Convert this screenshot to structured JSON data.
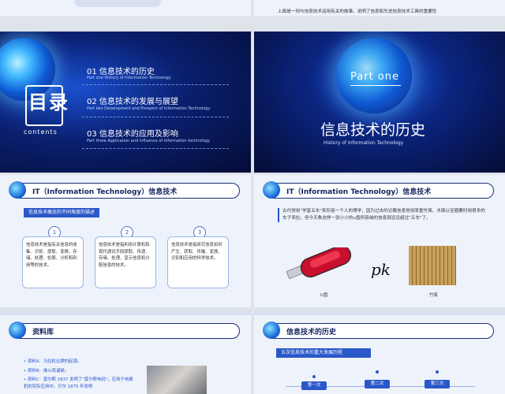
{
  "top_strip": {
    "caption": "上面是一则与信息技术运用有关的故事。说明了信息和先进信息技术工具的重要性"
  },
  "toc_slide": {
    "title": "目录",
    "subtitle": "contents",
    "items": [
      {
        "main": "01 信息技术的历史",
        "sub": "Part one History of Information Technology"
      },
      {
        "main": "02 信息技术的发展与展望",
        "sub": "Part two Development and Prospect of Information Technology"
      },
      {
        "main": "03 信息技术的应用及影响",
        "sub": "Part three Application and influence of information technology"
      }
    ]
  },
  "part_slide": {
    "badge": "Part one",
    "title": "信息技术的历史",
    "subtitle": "History of Information Technology"
  },
  "it_slide_left": {
    "header": "IT（Information Technology）信息技术",
    "tag": "信息技术概念的不同角度的描述",
    "cards": [
      {
        "num": "1",
        "text": "信息技术是指有关信息的收集、识别、提取、变换、存储、处理、检索、分析和利用等的技术。"
      },
      {
        "num": "2",
        "text": "信息技术是指利用计算机和现代通讯手段获取、传递、存储、处理、显示信息和分配信息的技术。"
      },
      {
        "num": "3",
        "text": "信息技术是指研究信息如何产生、获取、传输、变换、识别和应用的科学技术。"
      }
    ]
  },
  "it_slide_right": {
    "header": "IT（Information Technology）信息技术",
    "paragraph": "古代常用\"学富五车\"来形容一个人的博学，因为过去的记载信息常用笨重竹简、木简以至圈要时用很多的车子来拉，但今天象这样一张小小的u盘所容纳的信息就远远超过\"五车\"了。",
    "pk_label": "pk",
    "usb_caption": "U盘",
    "bamboo_caption": "竹简"
  },
  "resource_slide": {
    "header": "资料库",
    "items": [
      "资料A：马拉松比赛的起源。",
      "资料B：烽火戏诸侯。",
      "资料C：莫尔斯 1837 发明了\"莫尔斯电码\"，应用于电报机的实际应用中。贝尔 1875 年发明"
    ]
  },
  "history_slide": {
    "header": "信息技术的历史",
    "tag": "五次信息技术的重大发展历程",
    "steps": [
      "第一次",
      "第二次",
      "第三次"
    ]
  },
  "colors": {
    "navy": "#14245e",
    "accent_blue": "#2a57c9",
    "dark_bg": "#0a1f6e",
    "light_bg": "#eef3fb"
  }
}
